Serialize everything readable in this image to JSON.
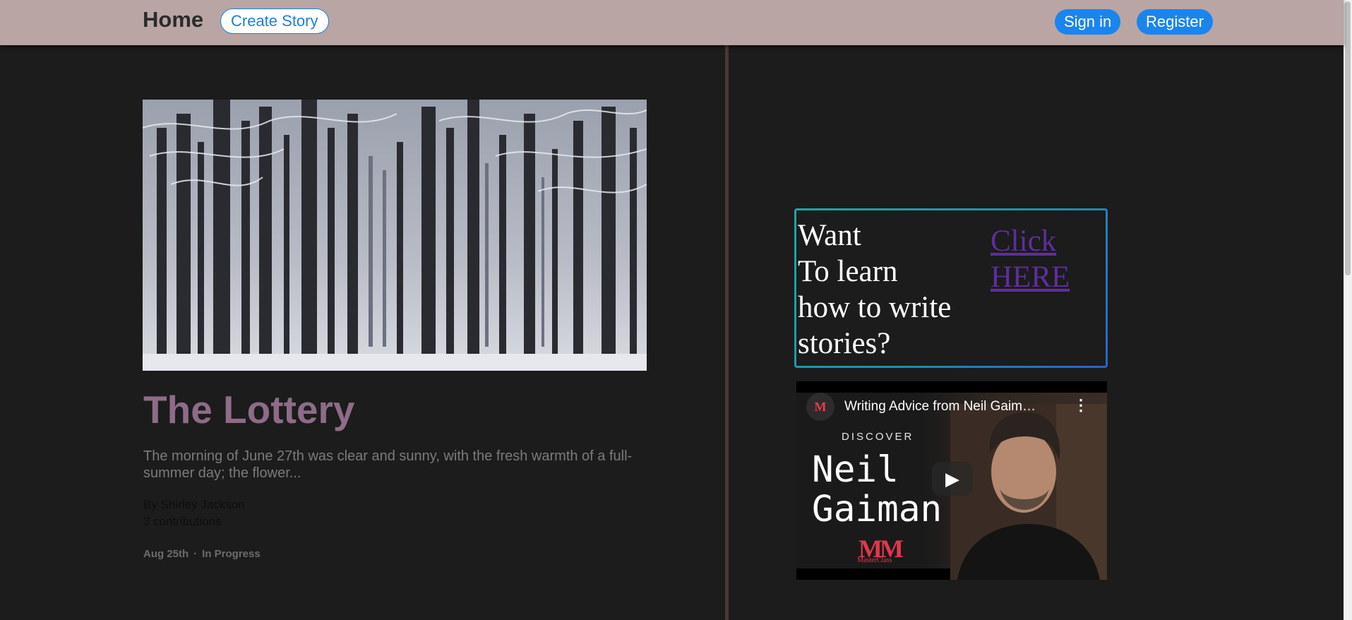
{
  "navbar": {
    "brand": "Home",
    "create_story": "Create Story",
    "sign_in": "Sign in",
    "register": "Register"
  },
  "story": {
    "image_icon": "winter-forest-photo",
    "title": "The Lottery",
    "excerpt": "The morning of June 27th was clear and sunny, with the fresh warmth of a full-summer day; the flower...",
    "author": "By Shirley Jackson",
    "contributions": "3 contributions",
    "date": "Aug 25th",
    "separator": "·",
    "status": "In Progress"
  },
  "learn": {
    "text_line1": "Want",
    "text_line2": "To learn",
    "text_line3": "how to write",
    "text_line4": "stories?",
    "link_line1": "Click",
    "link_line2": "HERE"
  },
  "video": {
    "title": "Writing Advice from Neil Gaiman ...",
    "category": "DISCOVER",
    "name_line1": "Neil",
    "name_line2": "Gaiman",
    "brand": "MasterClass",
    "play_icon": "play-icon",
    "more_icon": "kebab-icon"
  },
  "colors": {
    "navbar_bg": "#b9a5a4",
    "page_bg": "#1b1c1b",
    "primary_button": "#1a85ee",
    "story_title": "#8e6b88",
    "link": "#5f2d9c",
    "box_border": "#1aa8a5",
    "masterclass_red": "#e1374c"
  }
}
